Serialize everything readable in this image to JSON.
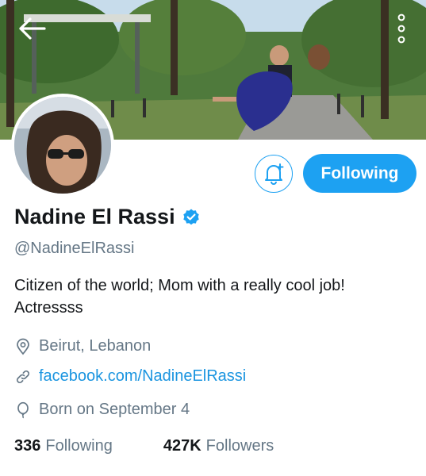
{
  "profile": {
    "name": "Nadine El Rassi",
    "handle": "@NadineElRassi",
    "bio": "Citizen of the world; Mom with a really cool job! Actressss",
    "location": "Beirut, Lebanon",
    "website": "facebook.com/NadineElRassi",
    "birthday": "Born on September 4",
    "verified": true
  },
  "actions": {
    "follow_label": "Following"
  },
  "stats": {
    "following_count": "336",
    "following_label": "Following",
    "followers_count": "427K",
    "followers_label": "Followers"
  },
  "icons": {
    "back": "back-arrow-icon",
    "more": "more-vertical-icon",
    "notify": "bell-plus-icon",
    "verified": "verified-badge-icon",
    "location": "location-pin-icon",
    "link": "link-icon",
    "birthday": "balloon-icon"
  },
  "colors": {
    "accent": "#1da1f2",
    "link": "#1b95e0",
    "muted": "#657786",
    "text": "#14171a"
  }
}
